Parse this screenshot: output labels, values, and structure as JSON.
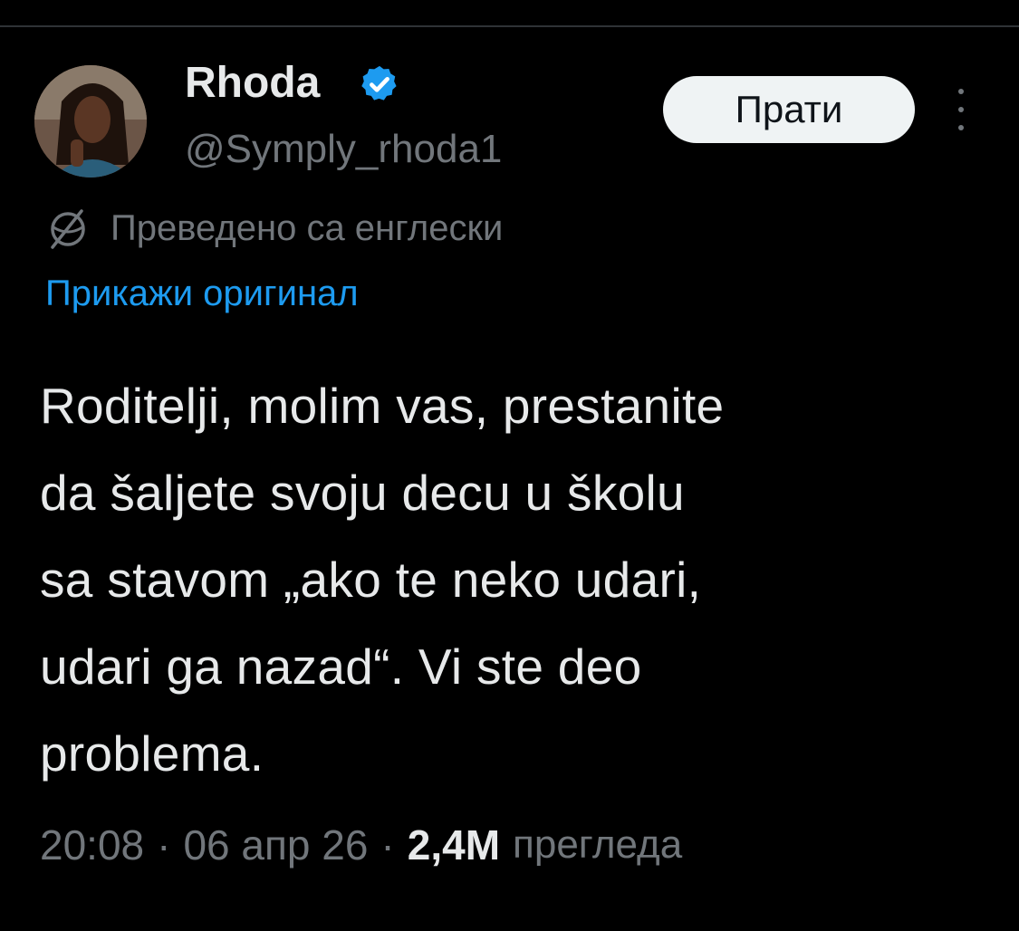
{
  "tweet": {
    "author": {
      "display_name": "Rhoda",
      "handle": "@Symply_rhoda1",
      "verified": true,
      "verified_icon": "verified-badge-icon",
      "avatar": "profile-photo"
    },
    "follow_label": "Прати",
    "more_icon": "more-options-icon",
    "translation": {
      "icon": "globe-icon",
      "label": "Преведено са енглески",
      "show_original": "Прикажи оригинал"
    },
    "text_lines": [
      "Roditelji, molim vas, prestanite",
      "da šaljete svoju decu u školu",
      "sa stavom „ako te neko udari,",
      "udari ga nazad“. Vi ste deo",
      "problema."
    ],
    "meta": {
      "time": "20:08",
      "separator": "·",
      "date": "06 апр 26",
      "views_count": "2,4M",
      "views_label": "прегледа"
    }
  },
  "colors": {
    "background": "#000000",
    "text_primary": "#e7e9ea",
    "text_secondary": "#71767b",
    "link": "#1d9bf0",
    "verified": "#1d9bf0",
    "button_bg": "#eff3f4",
    "button_text": "#0f1419",
    "divider": "#2f3336"
  }
}
